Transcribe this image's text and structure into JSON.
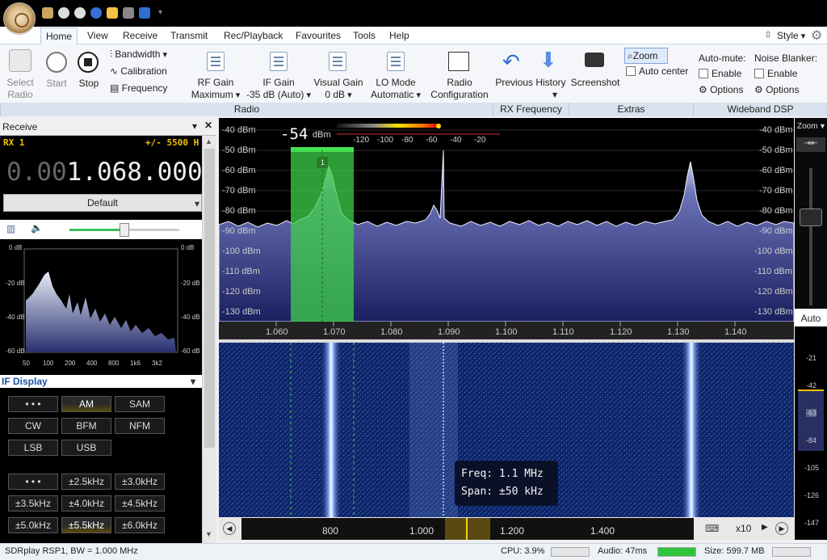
{
  "menu": {
    "tabs": [
      "Home",
      "View",
      "Receive",
      "Transmit",
      "Rec/Playback",
      "Favourites",
      "Tools",
      "Help"
    ],
    "style_label": "Style"
  },
  "ribbon": {
    "select_radio": "Select\nRadio",
    "start": "Start",
    "stop": "Stop",
    "bandwidth": "Bandwidth",
    "calibration": "Calibration",
    "frequency": "Frequency",
    "rf_gain": "RF Gain",
    "rf_gain_value": "Maximum",
    "if_gain": "IF Gain",
    "if_gain_value": "-35 dB (Auto)",
    "visual_gain": "Visual Gain",
    "visual_gain_value": "0 dB",
    "lo_mode": "LO Mode",
    "lo_mode_value": "Automatic",
    "radio_config_1": "Radio",
    "radio_config_2": "Configuration",
    "previous_history": "Previous History",
    "screenshot": "Screenshot",
    "zoom": "Zoom",
    "auto_center": "Auto center",
    "auto_mute": "Auto-mute:",
    "noise_blanker": "Noise Blanker:",
    "enable": "Enable",
    "options": "Options",
    "groups": [
      "Radio",
      "RX Frequency",
      "Extras",
      "Wideband DSP"
    ]
  },
  "receive_panel": {
    "title": "Receive",
    "rx_label": "RX 1",
    "offset": "+/- 5500 H",
    "freq_dim": "0.00",
    "freq_main": "1.068.000",
    "profile": "Default",
    "mini_db_labels": [
      "0 dB",
      "-20 dB",
      "-40 dB",
      "-60 dB"
    ],
    "mini_x_labels": [
      "50",
      "100",
      "200",
      "400",
      "800",
      "1k6",
      "3k2"
    ]
  },
  "if_display": {
    "title": "IF Display",
    "modes": [
      "• • •",
      "AM",
      "SAM",
      "CW",
      "BFM",
      "NFM",
      "LSB",
      "USB"
    ],
    "selected_mode": "AM",
    "bandwidths": [
      "• • •",
      "±2.5kHz",
      "±3.0kHz",
      "±3.5kHz",
      "±4.0kHz",
      "±4.5kHz",
      "±5.0kHz",
      "±5.5kHz",
      "±6.0kHz"
    ],
    "selected_bw": "±5.5kHz"
  },
  "spectrum": {
    "signal_level": "-54",
    "signal_unit": "dBm",
    "meter_ticks": [
      "-120",
      "-100",
      "-80",
      "-60",
      "-40",
      "-20"
    ],
    "db_labels": [
      "-40 dBm",
      "-50 dBm",
      "-60 dBm",
      "-70 dBm",
      "-80 dBm",
      "-90 dBm",
      "-100 dBm",
      "-110 dBm",
      "-120 dBm",
      "-130 dBm"
    ],
    "freq_labels": [
      "1.060",
      "1.070",
      "1.080",
      "1.090",
      "1.100",
      "1.110",
      "1.120",
      "1.130",
      "1.140"
    ],
    "vfo_marker": "1"
  },
  "waterfall": {
    "tooltip_freq": "Freq: 1.1 MHz",
    "tooltip_span": "Span: ±50 kHz",
    "overview_labels": [
      "800",
      "1.000",
      "1.200",
      "1.400"
    ],
    "zoom_factor": "x10"
  },
  "right_panel": {
    "zoom_label": "Zoom",
    "auto_label": "Auto",
    "scale": [
      "-21",
      "-42",
      "-63",
      "-84",
      "-105",
      "-126",
      "-147"
    ]
  },
  "status": {
    "device": "SDRplay RSP1, BW = 1.000 MHz",
    "cpu": "CPU: 3.9%",
    "audio": "Audio: 47ms",
    "size": "Size: 599.7 MB"
  },
  "colors": {
    "accent_blue": "#1a4fa3",
    "filter_green": "#3fd14a",
    "spectrum_fill": "#5561a8"
  }
}
